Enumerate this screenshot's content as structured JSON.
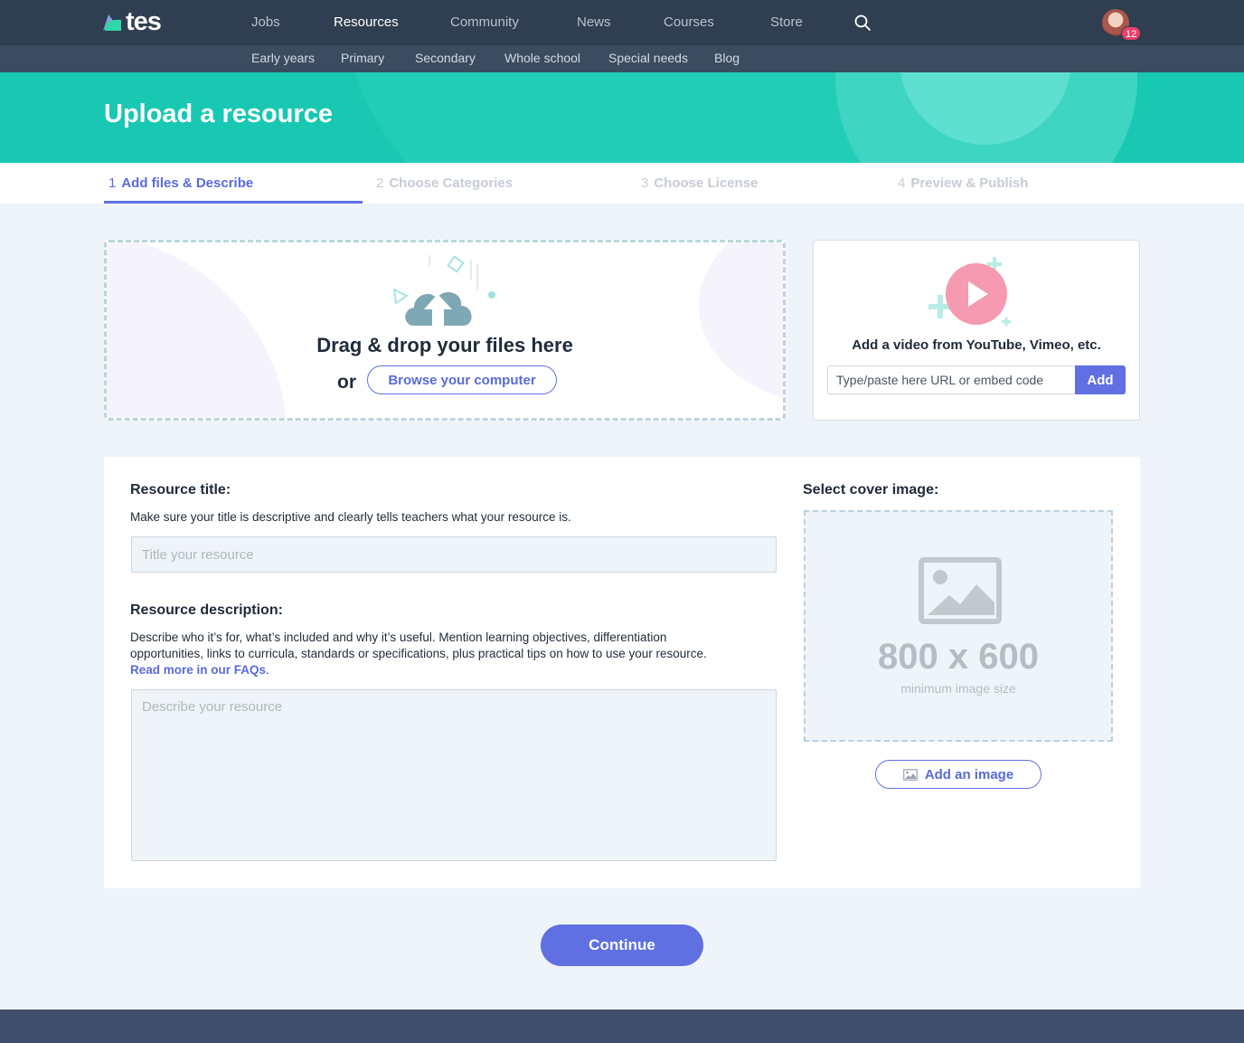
{
  "brand": {
    "name": "tes"
  },
  "nav": {
    "items": [
      "Jobs",
      "Resources",
      "Community",
      "News",
      "Courses",
      "Store"
    ],
    "active": "Resources",
    "notification_count": "12"
  },
  "subnav": {
    "items": [
      "Early years",
      "Primary",
      "Secondary",
      "Whole school",
      "Special needs",
      "Blog"
    ]
  },
  "hero": {
    "title": "Upload a resource"
  },
  "steps": [
    {
      "num": "1",
      "label": "Add files & Describe",
      "active": true
    },
    {
      "num": "2",
      "label": "Choose Categories",
      "active": false
    },
    {
      "num": "3",
      "label": "Choose License",
      "active": false
    },
    {
      "num": "4",
      "label": "Preview & Publish",
      "active": false
    }
  ],
  "dropzone": {
    "title": "Drag & drop your files here",
    "or": "or",
    "browse_label": "Browse your computer"
  },
  "video": {
    "label": "Add a video from YouTube, Vimeo, etc.",
    "placeholder": "Type/paste here URL or embed code",
    "add_label": "Add"
  },
  "form": {
    "title_label": "Resource title:",
    "title_help": "Make sure your title is descriptive and clearly tells teachers what your resource is.",
    "title_placeholder": "Title your resource",
    "desc_label": "Resource description:",
    "desc_help_line1": "Describe who it’s for, what’s included and why it’s useful. Mention learning objectives, differentiation",
    "desc_help_line2": "opportunities, links to curricula, standards or specifications, plus practical tips on how to use your resource.",
    "desc_help_link": "Read more in our FAQs",
    "desc_help_end": ".",
    "desc_placeholder": "Describe your resource",
    "cover_label": "Select cover image:",
    "cover_size": "800 x 600",
    "cover_sub": "minimum image size",
    "add_image_label": "Add an image"
  },
  "actions": {
    "continue_label": "Continue"
  },
  "colors": {
    "accent": "#6070e2",
    "teal": "#18c8b2",
    "nav_bg": "#2f3e50",
    "subnav_bg": "#3b4c60",
    "footer_bg": "#3f4e6b"
  }
}
